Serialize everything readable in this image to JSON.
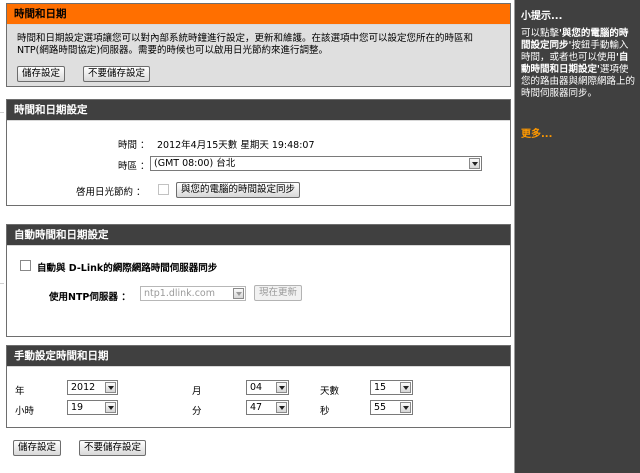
{
  "intro": {
    "title": "時間和日期",
    "desc": "時間和日期設定選項讓您可以對內部系統時鐘進行設定，更新和維護。在該選項中您可以設定您所在的時區和NTP(網路時間協定)伺服器。需要的時候也可以啟用日光節約來進行調整。",
    "save_label": "儲存設定",
    "nosave_label": "不要儲存設定"
  },
  "time_config": {
    "title": "時間和日期設定",
    "time_label": "時間 ：",
    "time_value": "2012年4月15天數 星期天 19:48:07",
    "timezone_label": "時區 ：",
    "timezone_value": "(GMT 08:00) 台北",
    "dst_label": "啓用日光節約 ：",
    "sync_pc_label": "與您的電腦的時間設定同步"
  },
  "auto_config": {
    "title": "自動時間和日期設定",
    "auto_sync_label": "自動與 D-Link的網際網路時間伺服器同步",
    "ntp_label": "使用NTP伺服器 ：",
    "ntp_value": "ntp1.dlink.com",
    "update_label": "現在更新"
  },
  "manual_config": {
    "title": "手動設定時間和日期",
    "year_label": "年",
    "year_value": "2012",
    "month_label": "月",
    "month_value": "04",
    "day_label": "天數",
    "day_value": "15",
    "hour_label": "小時",
    "hour_value": "19",
    "minute_label": "分",
    "minute_value": "47",
    "second_label": "秒",
    "second_value": "55"
  },
  "footer": {
    "save_label": "儲存設定",
    "nosave_label": "不要儲存設定"
  },
  "sidebar": {
    "title": "小提示...",
    "tip_pre": "可以點擊",
    "tip_bold1": "'與您的電腦的時間設定同步'",
    "tip_mid": "按鈕手動輸入時間，或者也可以使用",
    "tip_bold2": "'自動時間和日期設定'",
    "tip_post": "選項使您的路由器與網際網路上的時間伺服器同步。",
    "more_label": "更多..."
  },
  "colors": {
    "intro_header": "#ff6f00",
    "section_header": "#404040",
    "sidebar_bg": "#404040",
    "more_link": "#ff9900"
  }
}
